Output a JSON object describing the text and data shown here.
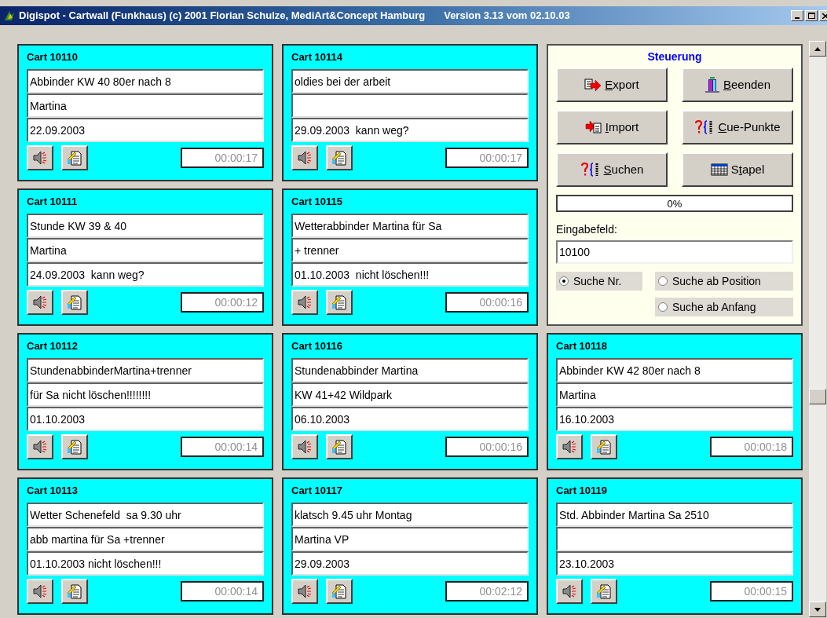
{
  "window": {
    "title": "Digispot - Cartwall (Funkhaus) (c) 2001 Florian Schulze, MediArt&Concept Hamburg",
    "version": "Version 3.13 vom 02.10.03"
  },
  "carts": [
    {
      "title": "Cart 10110",
      "line_1": "Abbinder KW 40 80er nach 8",
      "line_2": "Martina",
      "line_3": "22.09.2003",
      "duration": "00:00:17"
    },
    {
      "title": "Cart 10111",
      "line_1": "Stunde KW 39 & 40",
      "line_2": "Martina",
      "line_3": "24.09.2003  kann weg?",
      "duration": "00:00:12"
    },
    {
      "title": "Cart 10112",
      "line_1": "StundenabbinderMartina+trenner",
      "line_2": "für Sa nicht löschen!!!!!!!!",
      "line_3": "01.10.2003",
      "duration": "00:00:14"
    },
    {
      "title": "Cart 10113",
      "line_1": "Wetter Schenefeld  sa 9.30 uhr",
      "line_2": "abb martina für Sa +trenner",
      "line_3": "01.10.2003 nicht löschen!!!",
      "duration": "00:00:14"
    },
    {
      "title": "Cart 10114",
      "line_1": "oldies bei der arbeit",
      "line_3": "29.09.2003  kann weg?",
      "duration": "00:00:17"
    },
    {
      "title": "Cart 10115",
      "line_1": "Wetterabbinder Martina für Sa",
      "line_2": "+ trenner",
      "line_3": "01.10.2003  nicht löschen!!!",
      "duration": "00:00:16"
    },
    {
      "title": "Cart 10116",
      "line_1": "Stundenabbinder Martina",
      "line_2": "KW 41+42 Wildpark",
      "line_3": "06.10.2003",
      "duration": "00:00:16"
    },
    {
      "title": "Cart 10117",
      "line_1": "klatsch 9.45 uhr Montag",
      "line_2": "Martina VP",
      "line_3": "29.09.2003",
      "duration": "00:02:12"
    },
    {
      "title": "Cart 10118",
      "line_1": "Abbinder KW 42 80er nach 8",
      "line_2": "Martina",
      "line_3": "16.10.2003",
      "duration": "00:00:18"
    },
    {
      "title": "Cart 10119",
      "line_1": "Std. Abbinder Martina Sa 2510",
      "line_3": "23.10.2003",
      "duration": "00:00:15"
    }
  ],
  "control": {
    "title": "Steuerung",
    "buttons": [
      {
        "kind": "export",
        "key": "E",
        "rest": "xport"
      },
      {
        "kind": "exit",
        "key": "B",
        "rest": "eenden"
      },
      {
        "kind": "import",
        "key": "I",
        "rest": "mport"
      },
      {
        "kind": "cue",
        "key": "C",
        "rest": "ue-Punkte"
      },
      {
        "kind": "search",
        "key": "S",
        "rest": "uchen"
      },
      {
        "kind": "stack",
        "pre": "S",
        "key": "t",
        "rest": "apel"
      }
    ],
    "progress": {
      "level": 0,
      "label": "0%"
    },
    "input": {
      "label": "Eingabefeld:",
      "value": "10100"
    },
    "radios": [
      {
        "label": "Suche Nr.",
        "selected": true
      },
      {
        "label": "Suche ab Position",
        "selected": false
      },
      {
        "label": "Suche ab Anfang",
        "selected": false
      }
    ]
  }
}
